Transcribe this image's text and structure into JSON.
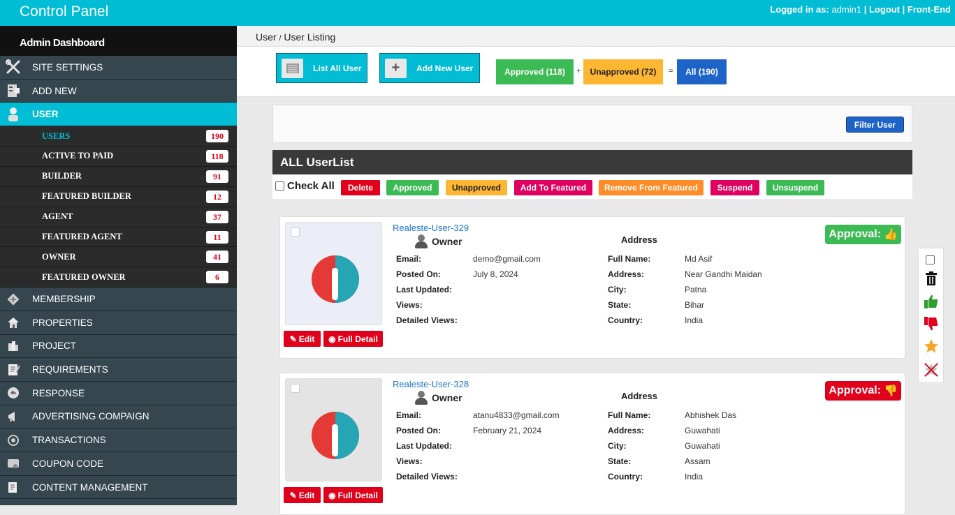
{
  "header": {
    "title": "Control Panel",
    "logged_label": "Logged in as:",
    "username": "admin1",
    "logout": "Logout",
    "frontend": "Front-End",
    "sep1": "|",
    "sep2": "|"
  },
  "sidebar": {
    "dashboard": "Admin Dashboard",
    "items_top": [
      {
        "label": "SITE SETTINGS",
        "icon": "settings-tools-icon"
      },
      {
        "label": "ADD NEW",
        "icon": "add-new-icon"
      },
      {
        "label": "USER",
        "icon": "user-icon"
      }
    ],
    "sub_items": [
      {
        "label": "USERS",
        "count": "190"
      },
      {
        "label": "ACTIVE TO PAID",
        "count": "118"
      },
      {
        "label": "BUILDER",
        "count": "91"
      },
      {
        "label": "FEATURED BUILDER",
        "count": "12"
      },
      {
        "label": "AGENT",
        "count": "37"
      },
      {
        "label": "FEATURED AGENT",
        "count": "11"
      },
      {
        "label": "OWNER",
        "count": "41"
      },
      {
        "label": "FEATURED OWNER",
        "count": "6"
      }
    ],
    "items_bottom": [
      {
        "label": "MEMBERSHIP",
        "icon": "membership-icon"
      },
      {
        "label": "PROPERTIES",
        "icon": "house-icon"
      },
      {
        "label": "PROJECT",
        "icon": "building-icon"
      },
      {
        "label": "REQUIREMENTS",
        "icon": "notepad-icon"
      },
      {
        "label": "RESPONSE",
        "icon": "reply-icon"
      },
      {
        "label": "ADVERTISING COMPAIGN",
        "icon": "megaphone-icon"
      },
      {
        "label": "TRANSACTIONS",
        "icon": "transactions-icon"
      },
      {
        "label": "COUPON CODE",
        "icon": "coupon-icon"
      },
      {
        "label": "CONTENT MANAGEMENT",
        "icon": "document-edit-icon"
      }
    ]
  },
  "breadcrumb": {
    "root": "User",
    "sep": "/",
    "current": "User Listing"
  },
  "toolbar": {
    "list_all": "List All User",
    "add_new": "Add New User"
  },
  "stats": {
    "approved": "Approved (118)",
    "plus": "+",
    "unapproved": "Unapproved (72)",
    "equals": "=",
    "all": "All (190)"
  },
  "filter": {
    "button": "Filter User"
  },
  "list": {
    "title": "ALL UserList"
  },
  "bulk": {
    "check_all": "Check All",
    "delete": "Delete",
    "approved": "Approved",
    "unapproved": "Unapproved",
    "add_featured": "Add To Featured",
    "remove_featured": "Remove From Featured",
    "suspend": "Suspend",
    "unsuspend": "Unsuspend"
  },
  "labels": {
    "email": "Email:",
    "posted": "Posted On:",
    "updated": "Last Updated:",
    "views": "Views:",
    "detailed": "Detailed Views:",
    "address_hdr": "Address",
    "fullname": "Full Name:",
    "address": "Address:",
    "city": "City:",
    "state": "State:",
    "country": "Country:",
    "edit": "Edit",
    "full_detail": "Full Detail",
    "approval": "Approval:"
  },
  "users": [
    {
      "name": "Realeste-User-329",
      "role": "Owner",
      "email": "demo@gmail.com",
      "posted": "July 8, 2024",
      "updated": "",
      "views": "",
      "detailed": "",
      "fullname": "Md Asif",
      "address": "Near Gandhi Maidan",
      "city": "Patna",
      "state": "Bihar",
      "country": "India",
      "approved": true
    },
    {
      "name": "Realeste-User-328",
      "role": "Owner",
      "email": "atanu4833@gmail.com",
      "posted": "February 21, 2024",
      "updated": "",
      "views": "",
      "detailed": "",
      "fullname": "Abhishek Das",
      "address": "Guwahati",
      "city": "Guwahati",
      "state": "Assam",
      "country": "India",
      "approved": false
    }
  ],
  "colors": {
    "accent": "#00bcd4",
    "danger": "#e0001b",
    "success": "#3cba54",
    "warning": "#ffb733",
    "primary": "#1e64c8"
  }
}
